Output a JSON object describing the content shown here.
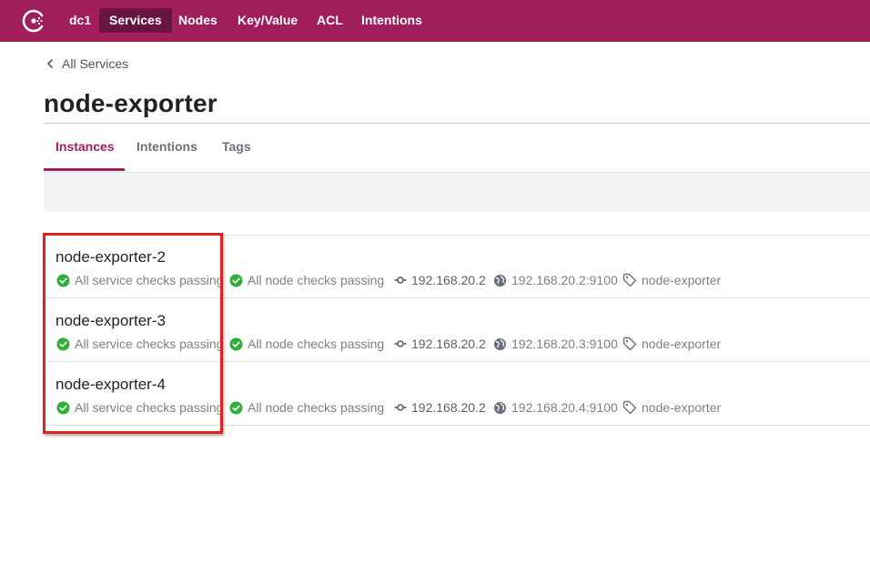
{
  "nav": {
    "datacenter": "dc1",
    "items": [
      "Services",
      "Nodes",
      "Key/Value",
      "ACL",
      "Intentions"
    ],
    "active": "Services"
  },
  "breadcrumb": {
    "label": "All Services"
  },
  "page": {
    "title": "node-exporter"
  },
  "tabs": [
    {
      "label": "Instances",
      "active": true
    },
    {
      "label": "Intentions",
      "active": false
    },
    {
      "label": "Tags",
      "active": false
    }
  ],
  "instances": [
    {
      "name": "node-exporter-2",
      "service_checks": "All service checks passing",
      "node_checks": "All node checks passing",
      "node_address": "192.168.20.2",
      "service_address": "192.168.20.2:9100",
      "tag": "node-exporter"
    },
    {
      "name": "node-exporter-3",
      "service_checks": "All service checks passing",
      "node_checks": "All node checks passing",
      "node_address": "192.168.20.2",
      "service_address": "192.168.20.3:9100",
      "tag": "node-exporter"
    },
    {
      "name": "node-exporter-4",
      "service_checks": "All service checks passing",
      "node_checks": "All node checks passing",
      "node_address": "192.168.20.2",
      "service_address": "192.168.20.4:9100",
      "tag": "node-exporter"
    }
  ],
  "colors": {
    "brand": "#a01e5a",
    "brand_active": "#6a1441",
    "passing": "#2eb039",
    "highlight": "#e0221f"
  },
  "icons": [
    "consul-logo-icon",
    "chevron-left-icon",
    "check-circle-icon",
    "node-address-icon",
    "globe-icon",
    "tag-icon"
  ]
}
